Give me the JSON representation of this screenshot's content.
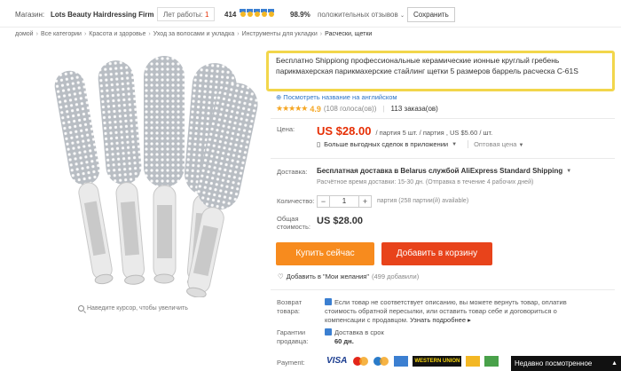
{
  "store_bar": {
    "store_label": "Магазин:",
    "store_name": "Lots Beauty Hairdressing Firm",
    "years_label": "Лет работы:",
    "years_value": "1",
    "score": "414",
    "positive_pct": "98.9%",
    "positive_label": "положительных отзывов",
    "save_button": "Сохранить"
  },
  "breadcrumb": [
    "домой",
    "Все категории",
    "Красота и здоровье",
    "Уход за волосами и укладка",
    "Инструменты для укладки",
    "Расчески, щетки"
  ],
  "gallery": {
    "zoom_hint": "Наведите курсор, чтобы увеличить"
  },
  "product": {
    "title": "Бесплатно Shippiong профессиональные керамические ионные круглый гребень парикмахерская парикмахерские стайлинг щетки 5 размеров баррель расческа C-61S",
    "english_link": "Посмотреть название на английском",
    "rating_value": "4.9",
    "votes": "(108 голоса(ов))",
    "orders": "113 заказа(ов)",
    "price_label": "Цена:",
    "price_main": "US $28.00",
    "price_sub": "/ партия 5 шт. / партия , US $5.60 / шт.",
    "deals_link": "Больше выгодных сделок в приложении",
    "wholesale": "Оптовая цена",
    "shipping_label": "Доставка:",
    "shipping_main": "Бесплатная доставка в Belarus службой AliExpress Standard Shipping",
    "shipping_sub": "Расчётное время доставки: 15-30 дн. (Отправка в течение 4 рабочих дней)",
    "quantity_label": "Количество:",
    "quantity_value": "1",
    "quantity_note": "партия (258 партии(й) available)",
    "total_label_1": "Общая",
    "total_label_2": "стоимость:",
    "total_value": "US $28.00",
    "buy_now": "Купить сейчас",
    "add_to_cart": "Добавить в корзину",
    "wishlist": "Добавить в \"Мои желания\"",
    "wishlist_count": "(499 добавили)",
    "returns_label_1": "Возврат",
    "returns_label_2": "товара:",
    "returns_text": "Если товар не соответствует описанию, вы можете вернуть товар, оплатив стоимость обратной пересылки, или оставить товар себе и договориться о компенсации с продавцом.",
    "returns_more": "Узнать подробнее",
    "guarantee_label_1": "Гарантии",
    "guarantee_label_2": "продавца:",
    "guarantee_text": "Доставка в срок",
    "guarantee_days": "60 дн.",
    "payment_label": "Payment:",
    "payment_visa": "VISA",
    "payment_wu": "WESTERN UNION"
  },
  "recently_viewed": "Недавно посмотренное",
  "colors": {
    "accent_red": "#e62e04",
    "buy_orange": "#f78b1e",
    "cart_red": "#e8431b",
    "title_highlight": "#f2d64b",
    "link_blue": "#2b74c7"
  }
}
